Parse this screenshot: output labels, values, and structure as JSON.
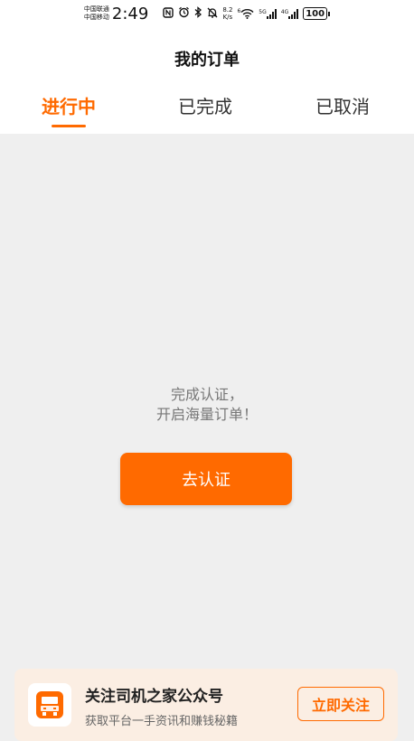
{
  "status_bar": {
    "carrier_1": "中国联通",
    "carrier_2": "中国移动",
    "time": "2:49",
    "net_speed_value": "8.2",
    "net_speed_unit": "K/s",
    "wifi_badge": "6",
    "sim1_net": "5G",
    "sim2_net": "4G",
    "battery": "100",
    "icons": [
      "nfc-icon",
      "alarm-icon",
      "bluetooth-icon",
      "mute-icon",
      "wifi-icon",
      "signal-icon",
      "signal-icon",
      "battery-icon"
    ]
  },
  "header": {
    "title": "我的订单"
  },
  "tabs": [
    {
      "label": "进行中",
      "active": true
    },
    {
      "label": "已完成",
      "active": false
    },
    {
      "label": "已取消",
      "active": false
    }
  ],
  "empty_state": {
    "line1": "完成认证，",
    "line2": "开启海量订单！",
    "button_label": "去认证"
  },
  "banner": {
    "icon": "truck-icon",
    "title": "关注司机之家公众号",
    "subtitle": "获取平台一手资讯和赚钱秘籍",
    "button_label": "立即关注"
  },
  "colors": {
    "accent": "#ff6a00",
    "content_bg": "#efefef",
    "banner_bg": "#fbeee3"
  }
}
